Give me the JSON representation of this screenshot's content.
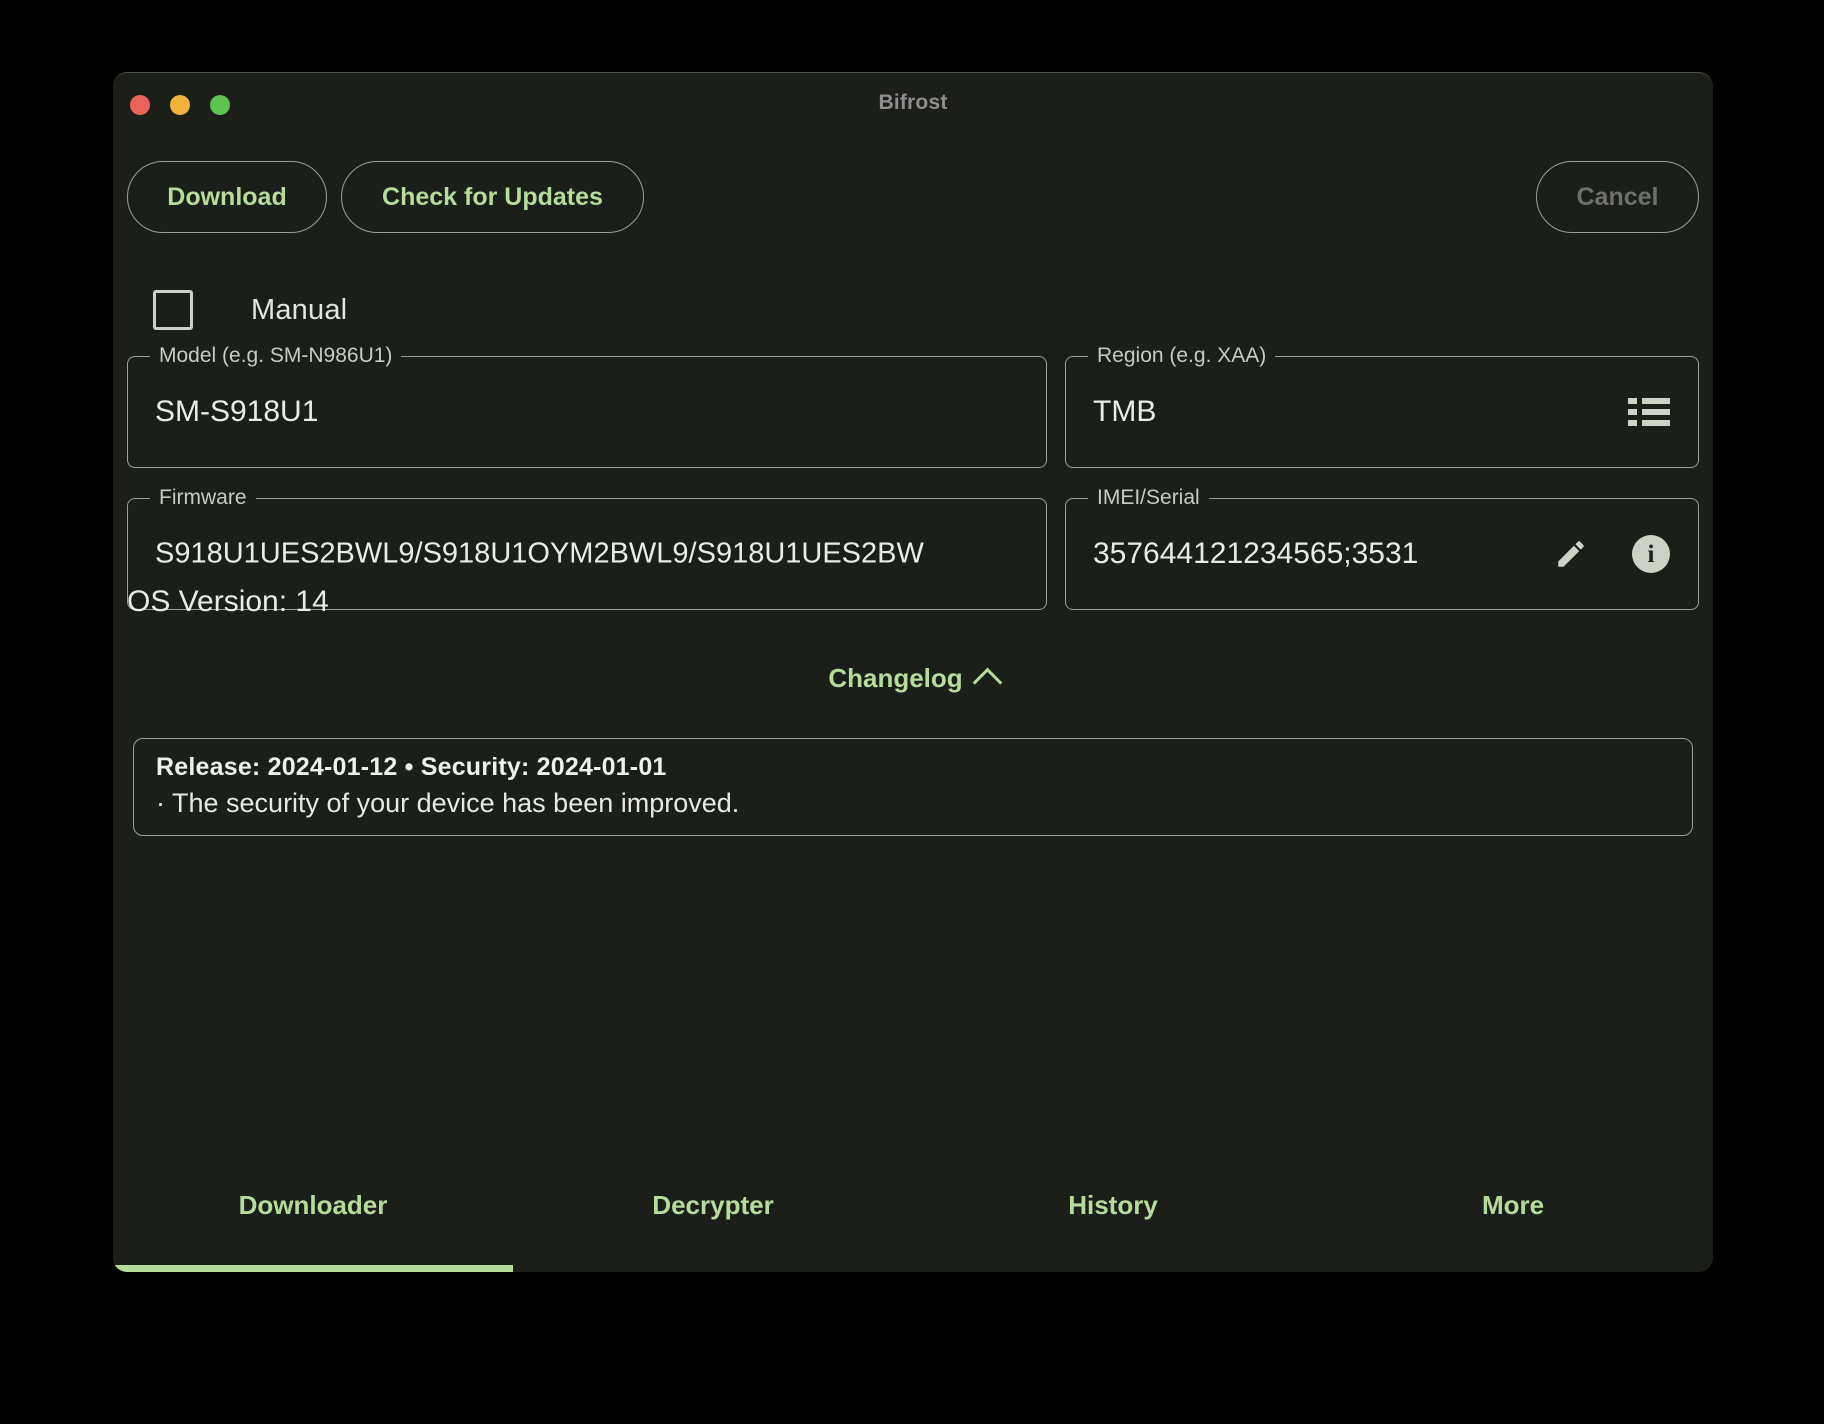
{
  "window": {
    "title": "Bifrost",
    "traffic_lights": [
      "close-button",
      "minimize-button",
      "maximize-button"
    ],
    "colors": {
      "background": "#000000",
      "surface": "#1c1e1a",
      "accent_green": "#b5dc9a",
      "border": "#9aa093",
      "text_primary": "#e9ece5",
      "text_muted": "#8d8d8d",
      "disabled": "#6e706b",
      "traffic_red": "#e8645a",
      "traffic_yellow": "#f2b33d",
      "traffic_green": "#5dc24f"
    }
  },
  "toolbar": {
    "download_label": "Download",
    "check_updates_label": "Check for Updates",
    "cancel_label": "Cancel",
    "cancel_disabled": true
  },
  "manual": {
    "label": "Manual",
    "checked": false
  },
  "fields": {
    "model": {
      "legend": "Model (e.g. SM-N986U1)",
      "value": "SM-S918U1",
      "placeholder": "SM-N986U1"
    },
    "region": {
      "legend": "Region (e.g. XAA)",
      "value": "TMB",
      "placeholder": "XAA",
      "icon": "list-icon"
    },
    "firmware": {
      "legend": "Firmware",
      "value": "S918U1UES2BWL9/S918U1OYM2BWL9/S918U1UES2BW",
      "placeholder": ""
    },
    "imei": {
      "legend": "IMEI/Serial",
      "value": "357644121234565;3531",
      "placeholder": "",
      "edit_icon": "pencil-icon",
      "info_icon": "info-icon",
      "info_glyph": "i"
    }
  },
  "os_version": {
    "text": "OS Version: 14"
  },
  "changelog": {
    "toggle_label": "Changelog",
    "expanded": true,
    "header": "Release: 2024-01-12  •  Security: 2024-01-01",
    "body": "· The security of your device has been improved."
  },
  "tabs": {
    "active_index": 0,
    "items": [
      {
        "label": "Downloader"
      },
      {
        "label": "Decrypter"
      },
      {
        "label": "History"
      },
      {
        "label": "More"
      }
    ]
  }
}
